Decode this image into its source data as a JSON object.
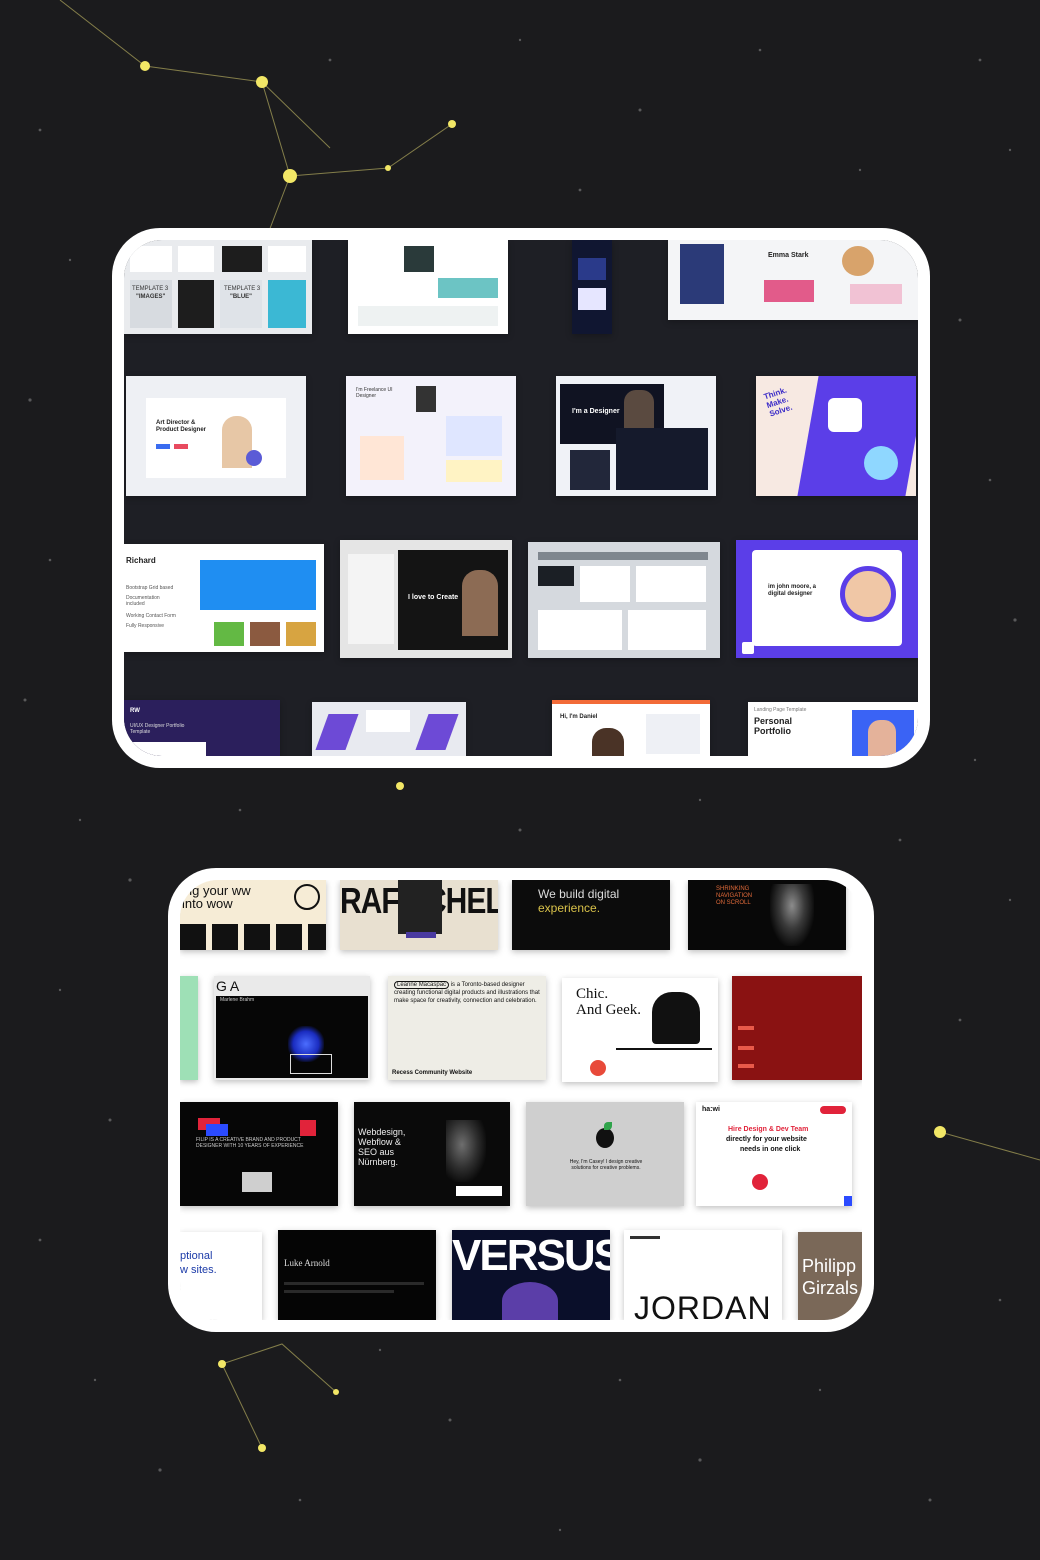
{
  "top_gallery": {
    "thumbnails": {
      "t1": {
        "label_a": "TEMPLATE 3",
        "label_b": "\"IMAGES\""
      },
      "t1b": {
        "label_a": "TEMPLATE 3",
        "label_b": "\"BLUE\""
      },
      "t4": {
        "name": "Emma Stark"
      },
      "t5": {
        "title": "Art Director & Product Designer"
      },
      "t6": {
        "title": "I'm Freelance UI Designer"
      },
      "t7": {
        "title": "I'm a Designer"
      },
      "t8": {
        "title": "Think. Make. Solve."
      },
      "t9": {
        "title": "Richard",
        "items": [
          "Bootstrap Grid based",
          "Documentation included",
          "Working Contact Form",
          "Fully Responsive"
        ]
      },
      "t11": {
        "title": "I love to Create"
      },
      "t13": {
        "title": "im john moore, a digital designer"
      },
      "t14": {
        "brand": "RW",
        "caption": "UI/UX Designer Portfolio Template"
      },
      "t16": {
        "title": "Hi, I'm Daniel"
      },
      "t17": {
        "subtitle": "Landing Page Template",
        "title": "Personal Portfolio"
      }
    }
  },
  "bottom_gallery": {
    "thumbnails": {
      "b1": {
        "text": "ing your ww into wow"
      },
      "b2": {
        "text": "RAFE CHEL"
      },
      "b3": {
        "line1": "We build digital",
        "line2": "experience."
      },
      "b4": {
        "text": "SHRINKING NAVIGATION ON SCROLL"
      },
      "b6": {
        "brand": "GA",
        "name": "Marlene Brahm"
      },
      "b7": {
        "name": "Leanne Macaspac",
        "text": "is a Toronto-based designer creating functional digital products and illustrations that make space for creativity, connection and celebration.",
        "footer": "Recess Community Website"
      },
      "b8": {
        "line1": "Chic.",
        "line2": "And Geek."
      },
      "b10": {
        "text": "FILIP IS A CREATIVE BRAND AND PRODUCT DESIGNER WITH 10 YEARS OF EXPERIENCE"
      },
      "b11": {
        "text": "Webdesign, Webflow & SEO aus Nürnberg."
      },
      "b12": {
        "text": "Hey, I'm Casey! I design creative solutions for creative problems."
      },
      "b13": {
        "brand": "ha:wi",
        "line1": "Hire Design & Dev Team",
        "line2": "directly for your website",
        "line3": "needs in one click"
      },
      "b14": {
        "line1": "ptional",
        "line2": "w sites."
      },
      "b15": {
        "name": "Luke Arnold"
      },
      "b16": {
        "text": "VERSUS"
      },
      "b17": {
        "text": "JORDAN"
      },
      "b18": {
        "line1": "Philipp",
        "line2": "Girzals"
      }
    }
  },
  "colors": {
    "background": "#1b1b1d",
    "star": "#f2e766",
    "top_panel": "#1e1f25",
    "purple": "#5b3ee8",
    "red": "#8a1212"
  }
}
